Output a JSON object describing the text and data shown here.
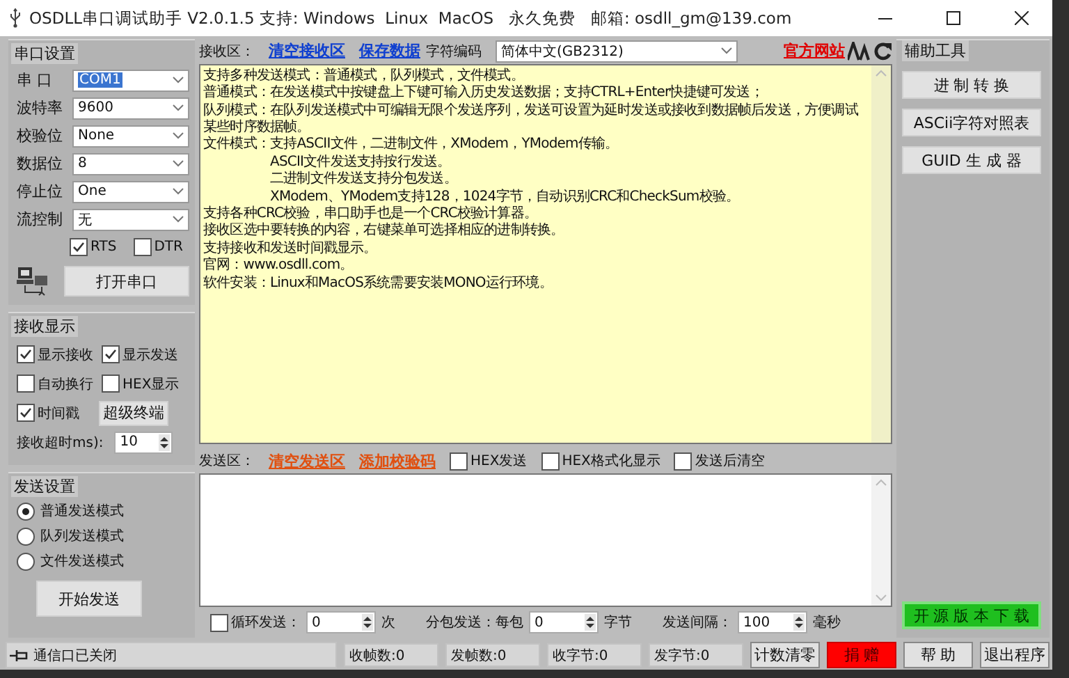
{
  "window": {
    "title": "OSDLL串口调试助手 V2.0.1.5 支持: Windows  Linux  MacOS   永久免费   邮箱: osdll_gm@139.com"
  },
  "serial_settings": {
    "title": "串口设置",
    "fields": [
      {
        "label": "串 口",
        "value": "COM1",
        "focused": true
      },
      {
        "label": "波特率",
        "value": "9600",
        "focused": false
      },
      {
        "label": "校验位",
        "value": "None",
        "focused": false
      },
      {
        "label": "数据位",
        "value": "8",
        "focused": false
      },
      {
        "label": "停止位",
        "value": "One",
        "focused": false
      },
      {
        "label": "流控制",
        "value": "无",
        "focused": false
      }
    ],
    "checkboxes": [
      {
        "label": "RTS",
        "checked": true
      },
      {
        "label": "DTR",
        "checked": false
      }
    ],
    "button": "打开串口"
  },
  "receive_display": {
    "title": "接收显示",
    "checkboxes": [
      {
        "label": "显示接收",
        "checked": true
      },
      {
        "label": "显示发送",
        "checked": true
      },
      {
        "label": "自动换行",
        "checked": false
      },
      {
        "label": "HEX显示",
        "checked": false
      },
      {
        "label": "时间戳",
        "checked": true
      }
    ],
    "button": "超级终端",
    "timeout_label": "接收超时ms):",
    "timeout_value": "10"
  },
  "send_settings": {
    "title": "发送设置",
    "radios": [
      {
        "label": "普通发送模式",
        "selected": true
      },
      {
        "label": "队列发送模式",
        "selected": false
      },
      {
        "label": "文件发送模式",
        "selected": false
      }
    ],
    "button": "开始发送"
  },
  "receive_area": {
    "label": "接收区：",
    "links": [
      "清空接收区",
      "保存数据"
    ],
    "encoding_label": "字符编码",
    "encoding_value": "简体中文(GB2312)",
    "website_link": "官方网站",
    "lines": [
      {
        "kind": "line",
        "text": "支持多种发送模式：普通模式，队列模式，文件模式。"
      },
      {
        "kind": "line",
        "text": "普通模式：在发送模式中按键盘上下键可输入历史发送数据；支持CTRL+Enter快捷键可发送；"
      },
      {
        "kind": "line",
        "text": "队列模式：在队列发送模式中可编辑无限个发送序列，发送可设置为延时发送或接收到数据帧后发送，方便调试"
      },
      {
        "kind": "line",
        "text": "某些时序数据帧。"
      },
      {
        "kind": "line",
        "text": "文件模式：支持ASCII文件，二进制文件，XModem，YModem传输。"
      },
      {
        "kind": "indented",
        "text": "ASCII文件发送支持按行发送。"
      },
      {
        "kind": "indented",
        "text": "二进制文件发送支持分包发送。"
      },
      {
        "kind": "indented",
        "text": "XModem、YModem支持128，1024字节，自动识别CRC和CheckSum校验。"
      },
      {
        "kind": "line",
        "text": "支持各种CRC校验，串口助手也是一个CRC校验计算器。"
      },
      {
        "kind": "line",
        "text": "接收区选中要转换的内容，右键菜单可选择相应的进制转换。"
      },
      {
        "kind": "line",
        "text": "支持接收和发送时间戳显示。"
      },
      {
        "kind": "line",
        "text": "官网：www.osdll.com。"
      },
      {
        "kind": "line",
        "text": "软件安装：Linux和MacOS系统需要安装MONO运行环境。"
      }
    ]
  },
  "send_area": {
    "label": "发送区：",
    "links": [
      "清空发送区",
      "添加校验码"
    ],
    "checkboxes": [
      {
        "label": "HEX发送",
        "checked": false
      },
      {
        "label": "HEX格式化显示",
        "checked": false
      },
      {
        "label": "发送后清空",
        "checked": false
      }
    ]
  },
  "send_options": {
    "loop": {
      "label": "循环发送：",
      "checked": false,
      "value": "0",
      "unit": "次"
    },
    "packet": {
      "label": "分包发送：每包",
      "value": "0",
      "unit": "字节"
    },
    "interval": {
      "label": "发送间隔：",
      "value": "100",
      "unit": "毫秒"
    }
  },
  "tools": {
    "title": "辅助工具",
    "buttons": [
      "进 制 转 换",
      "ASCii字符对照表",
      "GUID 生 成 器"
    ],
    "download_button": "开 源 版 本 下 载"
  },
  "status_bar": {
    "status": "通信口已关闭",
    "counters": [
      "收帧数:0",
      "发帧数:0",
      "收字节:0",
      "发字节:0"
    ],
    "buttons": [
      {
        "label": "计数清零",
        "kind": "normal"
      },
      {
        "label": "捐 赠",
        "kind": "donate"
      },
      {
        "label": "帮 助",
        "kind": "normal"
      },
      {
        "label": "退出程序",
        "kind": "normal"
      }
    ]
  }
}
